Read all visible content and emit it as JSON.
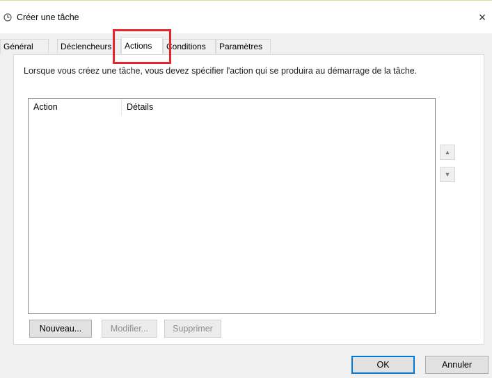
{
  "window": {
    "title": "Créer une tâche",
    "close_icon": "×"
  },
  "tabs": [
    {
      "label": "Général"
    },
    {
      "label": "Déclencheurs"
    },
    {
      "label": "Actions"
    },
    {
      "label": "Conditions"
    },
    {
      "label": "Paramètres"
    }
  ],
  "active_tab": "Actions",
  "highlight_color": "#e5252a",
  "panel": {
    "description": "Lorsque vous créez une tâche, vous devez spécifier l'action qui se produira au démarrage de la tâche.",
    "columns": [
      "Action",
      "Détails"
    ],
    "rows": [],
    "move_up_icon": "▲",
    "move_down_icon": "▼",
    "buttons": {
      "new": "Nouveau...",
      "modify": "Modifier...",
      "delete": "Supprimer"
    }
  },
  "footer": {
    "ok": "OK",
    "cancel": "Annuler"
  }
}
